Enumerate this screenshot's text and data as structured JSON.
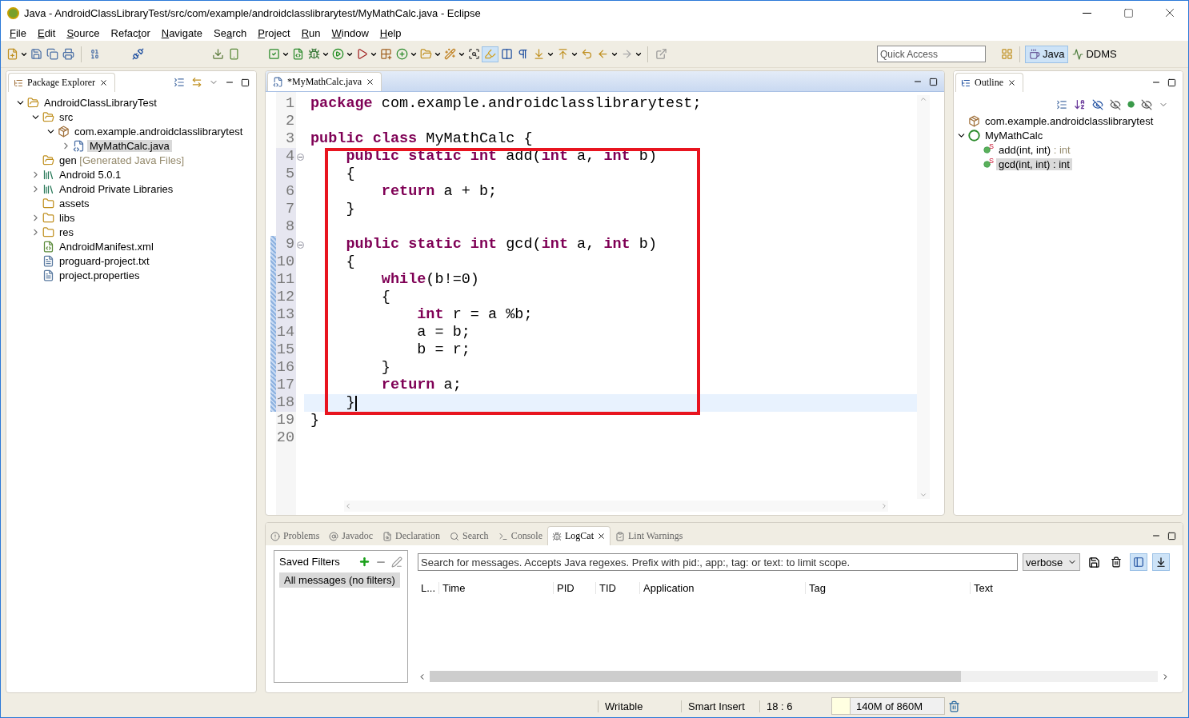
{
  "window": {
    "title": "Java - AndroidClassLibraryTest/src/com/example/androidclasslibrarytest/MyMathCalc.java - Eclipse"
  },
  "menu": [
    {
      "key": "F",
      "after": "ile"
    },
    {
      "key": "E",
      "after": "dit"
    },
    {
      "key": "S",
      "after": "ource"
    },
    {
      "before": "Refac",
      "key": "t",
      "after": "or"
    },
    {
      "key": "N",
      "after": "avigate"
    },
    {
      "before": "Se",
      "key": "a",
      "after": "rch"
    },
    {
      "key": "P",
      "after": "roject"
    },
    {
      "key": "R",
      "after": "un"
    },
    {
      "key": "W",
      "after": "indow"
    },
    {
      "key": "H",
      "after": "elp"
    }
  ],
  "toolbar": {
    "toggle_on": true,
    "quick_access": {
      "placeholder": "Quick Access"
    },
    "perspectives": [
      {
        "label": "Java",
        "selected": true
      },
      {
        "label": "DDMS",
        "selected": false
      }
    ]
  },
  "package_explorer": {
    "title": "Package Explorer",
    "tree": [
      {
        "label": "AndroidClassLibraryTest",
        "kind": "project",
        "selected": false,
        "expanded": true,
        "children": [
          {
            "label": "src",
            "kind": "srcfolder",
            "selected": false,
            "expanded": true,
            "children": [
              {
                "label": "com.example.androidclasslibrarytest",
                "kind": "package",
                "selected": false,
                "expanded": true,
                "children": [
                  {
                    "label": "MyMathCalc.java",
                    "kind": "java",
                    "selected": true,
                    "expanded": false
                  }
                ]
              }
            ]
          },
          {
            "label": "gen",
            "decoration": "[Generated Java Files]",
            "kind": "srcfolder",
            "selected": false
          },
          {
            "label": "Android 5.0.1",
            "kind": "library",
            "selected": false,
            "expanded": false
          },
          {
            "label": "Android Private Libraries",
            "kind": "library",
            "selected": false,
            "expanded": false
          },
          {
            "label": "assets",
            "kind": "folder",
            "selected": false
          },
          {
            "label": "libs",
            "kind": "folder",
            "selected": false,
            "expanded": false
          },
          {
            "label": "res",
            "kind": "folder",
            "selected": false,
            "expanded": false
          },
          {
            "label": "AndroidManifest.xml",
            "kind": "xml",
            "selected": false
          },
          {
            "label": "proguard-project.txt",
            "kind": "text",
            "selected": false
          },
          {
            "label": "project.properties",
            "kind": "text",
            "selected": false
          }
        ]
      }
    ]
  },
  "editor": {
    "tab": {
      "label": "*MyMathCalc.java",
      "selected": true
    },
    "lines": [
      {
        "n": "1",
        "code": "**package** com.example.androidclasslibrarytest;",
        "changed": false,
        "marked": false
      },
      {
        "n": "2",
        "changed": false,
        "marked": false
      },
      {
        "n": "3",
        "code": "**public class** MyMathCalc {",
        "changed": false,
        "marked": false
      },
      {
        "n": "4",
        "code": "    **public static int** add(**int** a, **int** b)",
        "changed": true,
        "marked": false,
        "fold": true
      },
      {
        "n": "5",
        "code": "    {",
        "changed": true,
        "marked": false
      },
      {
        "n": "6",
        "code": "        **return** a + b;",
        "changed": true,
        "marked": false
      },
      {
        "n": "7",
        "code": "    }",
        "changed": true,
        "marked": false
      },
      {
        "n": "8",
        "changed": true,
        "marked": false
      },
      {
        "n": "9",
        "code": "    **public static int** gcd(**int** a, **int** b)",
        "changed": true,
        "marked": true,
        "fold": true
      },
      {
        "n": "10",
        "code": "    {",
        "changed": true,
        "marked": true
      },
      {
        "n": "11",
        "code": "        **while**(b!=0)",
        "changed": true,
        "marked": true
      },
      {
        "n": "12",
        "code": "        {",
        "changed": true,
        "marked": true
      },
      {
        "n": "13",
        "code": "            **int** r = a %b;",
        "changed": true,
        "marked": true
      },
      {
        "n": "14",
        "code": "            a = b;",
        "changed": true,
        "marked": true
      },
      {
        "n": "15",
        "code": "            b = r;",
        "changed": true,
        "marked": true
      },
      {
        "n": "16",
        "code": "        }",
        "changed": true,
        "marked": true
      },
      {
        "n": "17",
        "code": "        **return** a;",
        "changed": true,
        "marked": true
      },
      {
        "n": "18",
        "code": "    }",
        "changed": true,
        "marked": true,
        "current": true
      },
      {
        "n": "19",
        "code": "}",
        "changed": false,
        "marked": false
      },
      {
        "n": "20",
        "changed": false,
        "marked": false
      }
    ]
  },
  "outline": {
    "title": "Outline",
    "tree": [
      {
        "label": "com.example.androidclasslibrarytest",
        "kind": "package",
        "selected": false
      },
      {
        "label": "MyMathCalc",
        "kind": "class",
        "selected": false,
        "expanded": true,
        "children": [
          {
            "label": "add(int, int)",
            "type": " : int",
            "static_mark": "S",
            "kind": "method",
            "selected": false
          },
          {
            "label": "gcd(int, int)",
            "type": " : int",
            "static_mark": "S",
            "kind": "method",
            "selected": true
          }
        ]
      }
    ]
  },
  "bottom_tabs": [
    {
      "label": "Problems",
      "selected": false
    },
    {
      "label": "Javadoc",
      "selected": false
    },
    {
      "label": "Declaration",
      "selected": false
    },
    {
      "label": "Search",
      "selected": false
    },
    {
      "label": "Console",
      "selected": false
    },
    {
      "label": "LogCat",
      "selected": true
    },
    {
      "label": "Lint Warnings",
      "selected": false
    }
  ],
  "logcat": {
    "saved_filters": {
      "title": "Saved Filters",
      "items": [
        {
          "label": "All messages (no filters)",
          "selected": true
        }
      ]
    },
    "search": {
      "placeholder": "Search for messages. Accepts Java regexes. Prefix with pid:, app:, tag: or text: to limit scope."
    },
    "level": "verbose",
    "pane_toggle_on": true,
    "autoscroll_on": true,
    "columns": [
      "L...",
      "Time",
      "PID",
      "TID",
      "Application",
      "Tag",
      "Text"
    ]
  },
  "status_bar": {
    "mode": "Writable",
    "insert": "Smart Insert",
    "position": "18 : 6",
    "heap": {
      "text": "140M of 860M",
      "level": 0.163
    }
  }
}
